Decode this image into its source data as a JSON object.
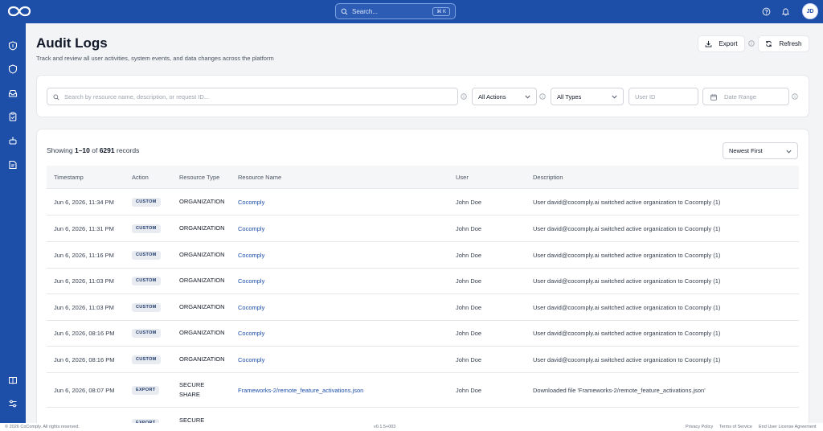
{
  "topbar": {
    "search_placeholder": "Search...",
    "search_shortcut": "⌘ K",
    "user_initials": "JD",
    "icons": [
      "logo-icon",
      "help-icon",
      "bell-icon"
    ]
  },
  "sidebar": {
    "icons": [
      "shield-icon",
      "shield-outline-icon",
      "inbox-icon",
      "clipboard-icon",
      "robot-icon",
      "document-icon",
      "book-icon",
      "settings-sliders-icon"
    ]
  },
  "header": {
    "title": "Audit Logs",
    "subtitle": "Track and review all user activities, system events, and data changes across the platform",
    "export_label": "Export",
    "refresh_label": "Refresh"
  },
  "filters": {
    "search_placeholder": "Search by resource name, description, or request ID...",
    "action_value": "All Actions",
    "type_value": "All Types",
    "user_placeholder": "User ID",
    "date_placeholder": "Date Range"
  },
  "results": {
    "prefix": "Showing ",
    "range": "1–10",
    "middle": " of ",
    "total": "6291",
    "suffix": " records",
    "sort_value": "Newest First"
  },
  "table": {
    "columns": [
      "Timestamp",
      "Action",
      "Resource Type",
      "Resource Name",
      "User",
      "Description"
    ],
    "rows": [
      {
        "timestamp": "Jun 6, 2026, 11:34 PM",
        "action": "CUSTOM",
        "resource_type": "ORGANIZATION",
        "resource_name": "Cocomply",
        "user": "John Doe",
        "description": "User david@cocomply.ai switched active organization to Cocomply (1)"
      },
      {
        "timestamp": "Jun 6, 2026, 11:31 PM",
        "action": "CUSTOM",
        "resource_type": "ORGANIZATION",
        "resource_name": "Cocomply",
        "user": "John Doe",
        "description": "User david@cocomply.ai switched active organization to Cocomply (1)"
      },
      {
        "timestamp": "Jun 6, 2026, 11:16 PM",
        "action": "CUSTOM",
        "resource_type": "ORGANIZATION",
        "resource_name": "Cocomply",
        "user": "John Doe",
        "description": "User david@cocomply.ai switched active organization to Cocomply (1)"
      },
      {
        "timestamp": "Jun 6, 2026, 11:03 PM",
        "action": "CUSTOM",
        "resource_type": "ORGANIZATION",
        "resource_name": "Cocomply",
        "user": "John Doe",
        "description": "User david@cocomply.ai switched active organization to Cocomply (1)"
      },
      {
        "timestamp": "Jun 6, 2026, 11:03 PM",
        "action": "CUSTOM",
        "resource_type": "ORGANIZATION",
        "resource_name": "Cocomply",
        "user": "John Doe",
        "description": "User david@cocomply.ai switched active organization to Cocomply (1)"
      },
      {
        "timestamp": "Jun 6, 2026, 08:16 PM",
        "action": "CUSTOM",
        "resource_type": "ORGANIZATION",
        "resource_name": "Cocomply",
        "user": "John Doe",
        "description": "User david@cocomply.ai switched active organization to Cocomply (1)"
      },
      {
        "timestamp": "Jun 6, 2026, 08:16 PM",
        "action": "CUSTOM",
        "resource_type": "ORGANIZATION",
        "resource_name": "Cocomply",
        "user": "John Doe",
        "description": "User david@cocomply.ai switched active organization to Cocomply (1)"
      },
      {
        "timestamp": "Jun 6, 2026, 08:07 PM",
        "action": "EXPORT",
        "resource_type_line1": "SECURE",
        "resource_type_line2": "SHARE",
        "resource_name": "Frameworks-2/remote_feature_activations.json",
        "user": "John Doe",
        "description": "Downloaded file 'Frameworks-2/remote_feature_activations.json'"
      },
      {
        "action": "EXPORT",
        "resource_type_line1": "SECURE"
      }
    ]
  },
  "footer": {
    "copyright": "© 2026 CoComply. All rights reserved.",
    "version": "v0.1.5+003",
    "privacy": "Privacy Policy",
    "terms": "Terms of Service",
    "eula": "End User License Agreement"
  },
  "colors": {
    "brand": "#1d4ea8",
    "link": "#1d4ea8",
    "page_bg": "#f3f4f6"
  }
}
